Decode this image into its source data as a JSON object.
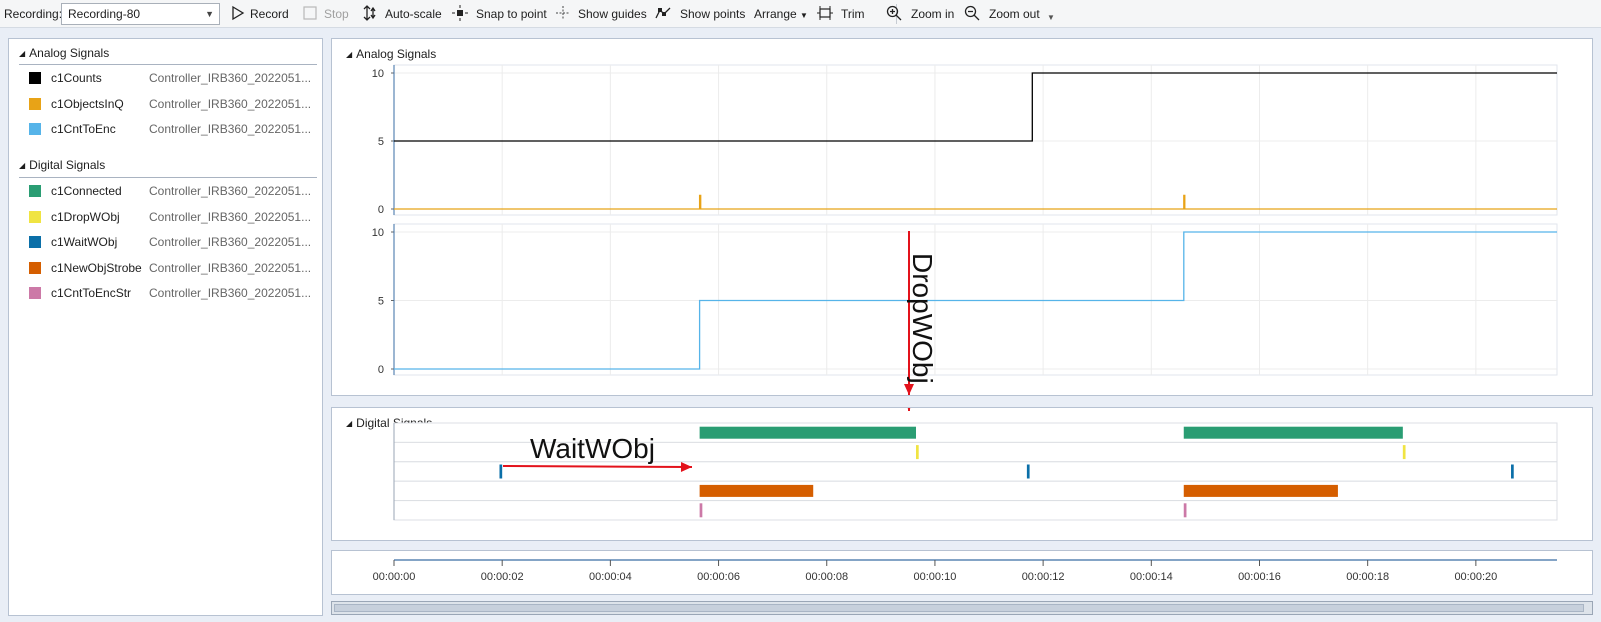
{
  "toolbar": {
    "recording_label": "Recording:",
    "recording_value": "Recording-80",
    "record": "Record",
    "stop": "Stop",
    "auto_scale": "Auto-scale",
    "snap_to_point": "Snap to point",
    "show_guides": "Show guides",
    "show_points": "Show points",
    "arrange": "Arrange",
    "trim": "Trim",
    "zoom_in": "Zoom in",
    "zoom_out": "Zoom out"
  },
  "left_panel": {
    "analog_header": "Analog Signals",
    "digital_header": "Digital Signals",
    "analog": [
      {
        "name": "c1Counts",
        "source": "Controller_IRB360_2022051...",
        "color": "#000000"
      },
      {
        "name": "c1ObjectsInQ",
        "source": "Controller_IRB360_2022051...",
        "color": "#e8a317"
      },
      {
        "name": "c1CntToEnc",
        "source": "Controller_IRB360_2022051...",
        "color": "#56b4e9"
      }
    ],
    "digital": [
      {
        "name": "c1Connected",
        "source": "Controller_IRB360_2022051...",
        "color": "#2a9d73"
      },
      {
        "name": "c1DropWObj",
        "source": "Controller_IRB360_2022051...",
        "color": "#f0e442"
      },
      {
        "name": "c1WaitWObj",
        "source": "Controller_IRB360_2022051...",
        "color": "#0b6fa8"
      },
      {
        "name": "c1NewObjStrobe",
        "source": "Controller_IRB360_2022051...",
        "color": "#d55e00"
      },
      {
        "name": "c1CntToEncStr",
        "source": "Controller_IRB360_2022051...",
        "color": "#cc79a7"
      }
    ]
  },
  "analog_panel": {
    "title": "Analog Signals",
    "chart1_ticks": [
      "10",
      "5",
      "0"
    ],
    "chart2_ticks": [
      "10",
      "5",
      "0"
    ]
  },
  "digital_panel": {
    "title": "Digital Signals"
  },
  "annotations": {
    "drop": "DropWObj",
    "wait": "WaitWObj",
    "arrow_color": "#e3121b"
  },
  "chart_data": {
    "type": "line",
    "x_unit": "seconds",
    "xlim": [
      0,
      21.5
    ],
    "time_ticks": [
      "00:00:00",
      "00:00:02",
      "00:00:04",
      "00:00:06",
      "00:00:08",
      "00:00:10",
      "00:00:12",
      "00:00:14",
      "00:00:16",
      "00:00:18",
      "00:00:20"
    ],
    "analog_chart_1": {
      "ylim": [
        0,
        10
      ],
      "series": [
        {
          "name": "c1Counts",
          "color": "#000000",
          "points": [
            [
              0,
              5
            ],
            [
              11.8,
              5
            ],
            [
              11.8,
              10
            ],
            [
              21.5,
              10
            ]
          ]
        },
        {
          "name": "c1ObjectsInQ",
          "color": "#e8a317",
          "points": [
            [
              0,
              0
            ],
            [
              5.65,
              0
            ],
            [
              5.65,
              1
            ],
            [
              5.67,
              1
            ],
            [
              5.67,
              0
            ],
            [
              14.6,
              0
            ],
            [
              14.6,
              1
            ],
            [
              14.62,
              1
            ],
            [
              14.62,
              0
            ],
            [
              21.5,
              0
            ]
          ]
        }
      ]
    },
    "analog_chart_2": {
      "ylim": [
        0,
        10
      ],
      "series": [
        {
          "name": "c1CntToEnc",
          "color": "#56b4e9",
          "points": [
            [
              0,
              0
            ],
            [
              5.65,
              0
            ],
            [
              5.65,
              5
            ],
            [
              14.6,
              5
            ],
            [
              14.6,
              10
            ],
            [
              21.5,
              10
            ]
          ]
        }
      ]
    },
    "digital": [
      {
        "name": "c1Connected",
        "color": "#2a9d73",
        "pulses": [
          [
            5.65,
            9.65
          ],
          [
            14.6,
            18.65
          ]
        ]
      },
      {
        "name": "c1DropWObj",
        "color": "#f0e442",
        "pulses": [
          [
            9.65,
            9.7
          ],
          [
            18.65,
            18.7
          ]
        ]
      },
      {
        "name": "c1WaitWObj",
        "color": "#0b6fa8",
        "pulses": [
          [
            1.95,
            2.0
          ],
          [
            11.7,
            11.75
          ],
          [
            20.65,
            20.7
          ]
        ]
      },
      {
        "name": "c1NewObjStrobe",
        "color": "#d55e00",
        "pulses": [
          [
            5.65,
            7.75
          ],
          [
            14.6,
            17.45
          ]
        ]
      },
      {
        "name": "c1CntToEncStr",
        "color": "#cc79a7",
        "pulses": [
          [
            5.65,
            5.7
          ],
          [
            14.6,
            14.65
          ]
        ]
      }
    ]
  }
}
